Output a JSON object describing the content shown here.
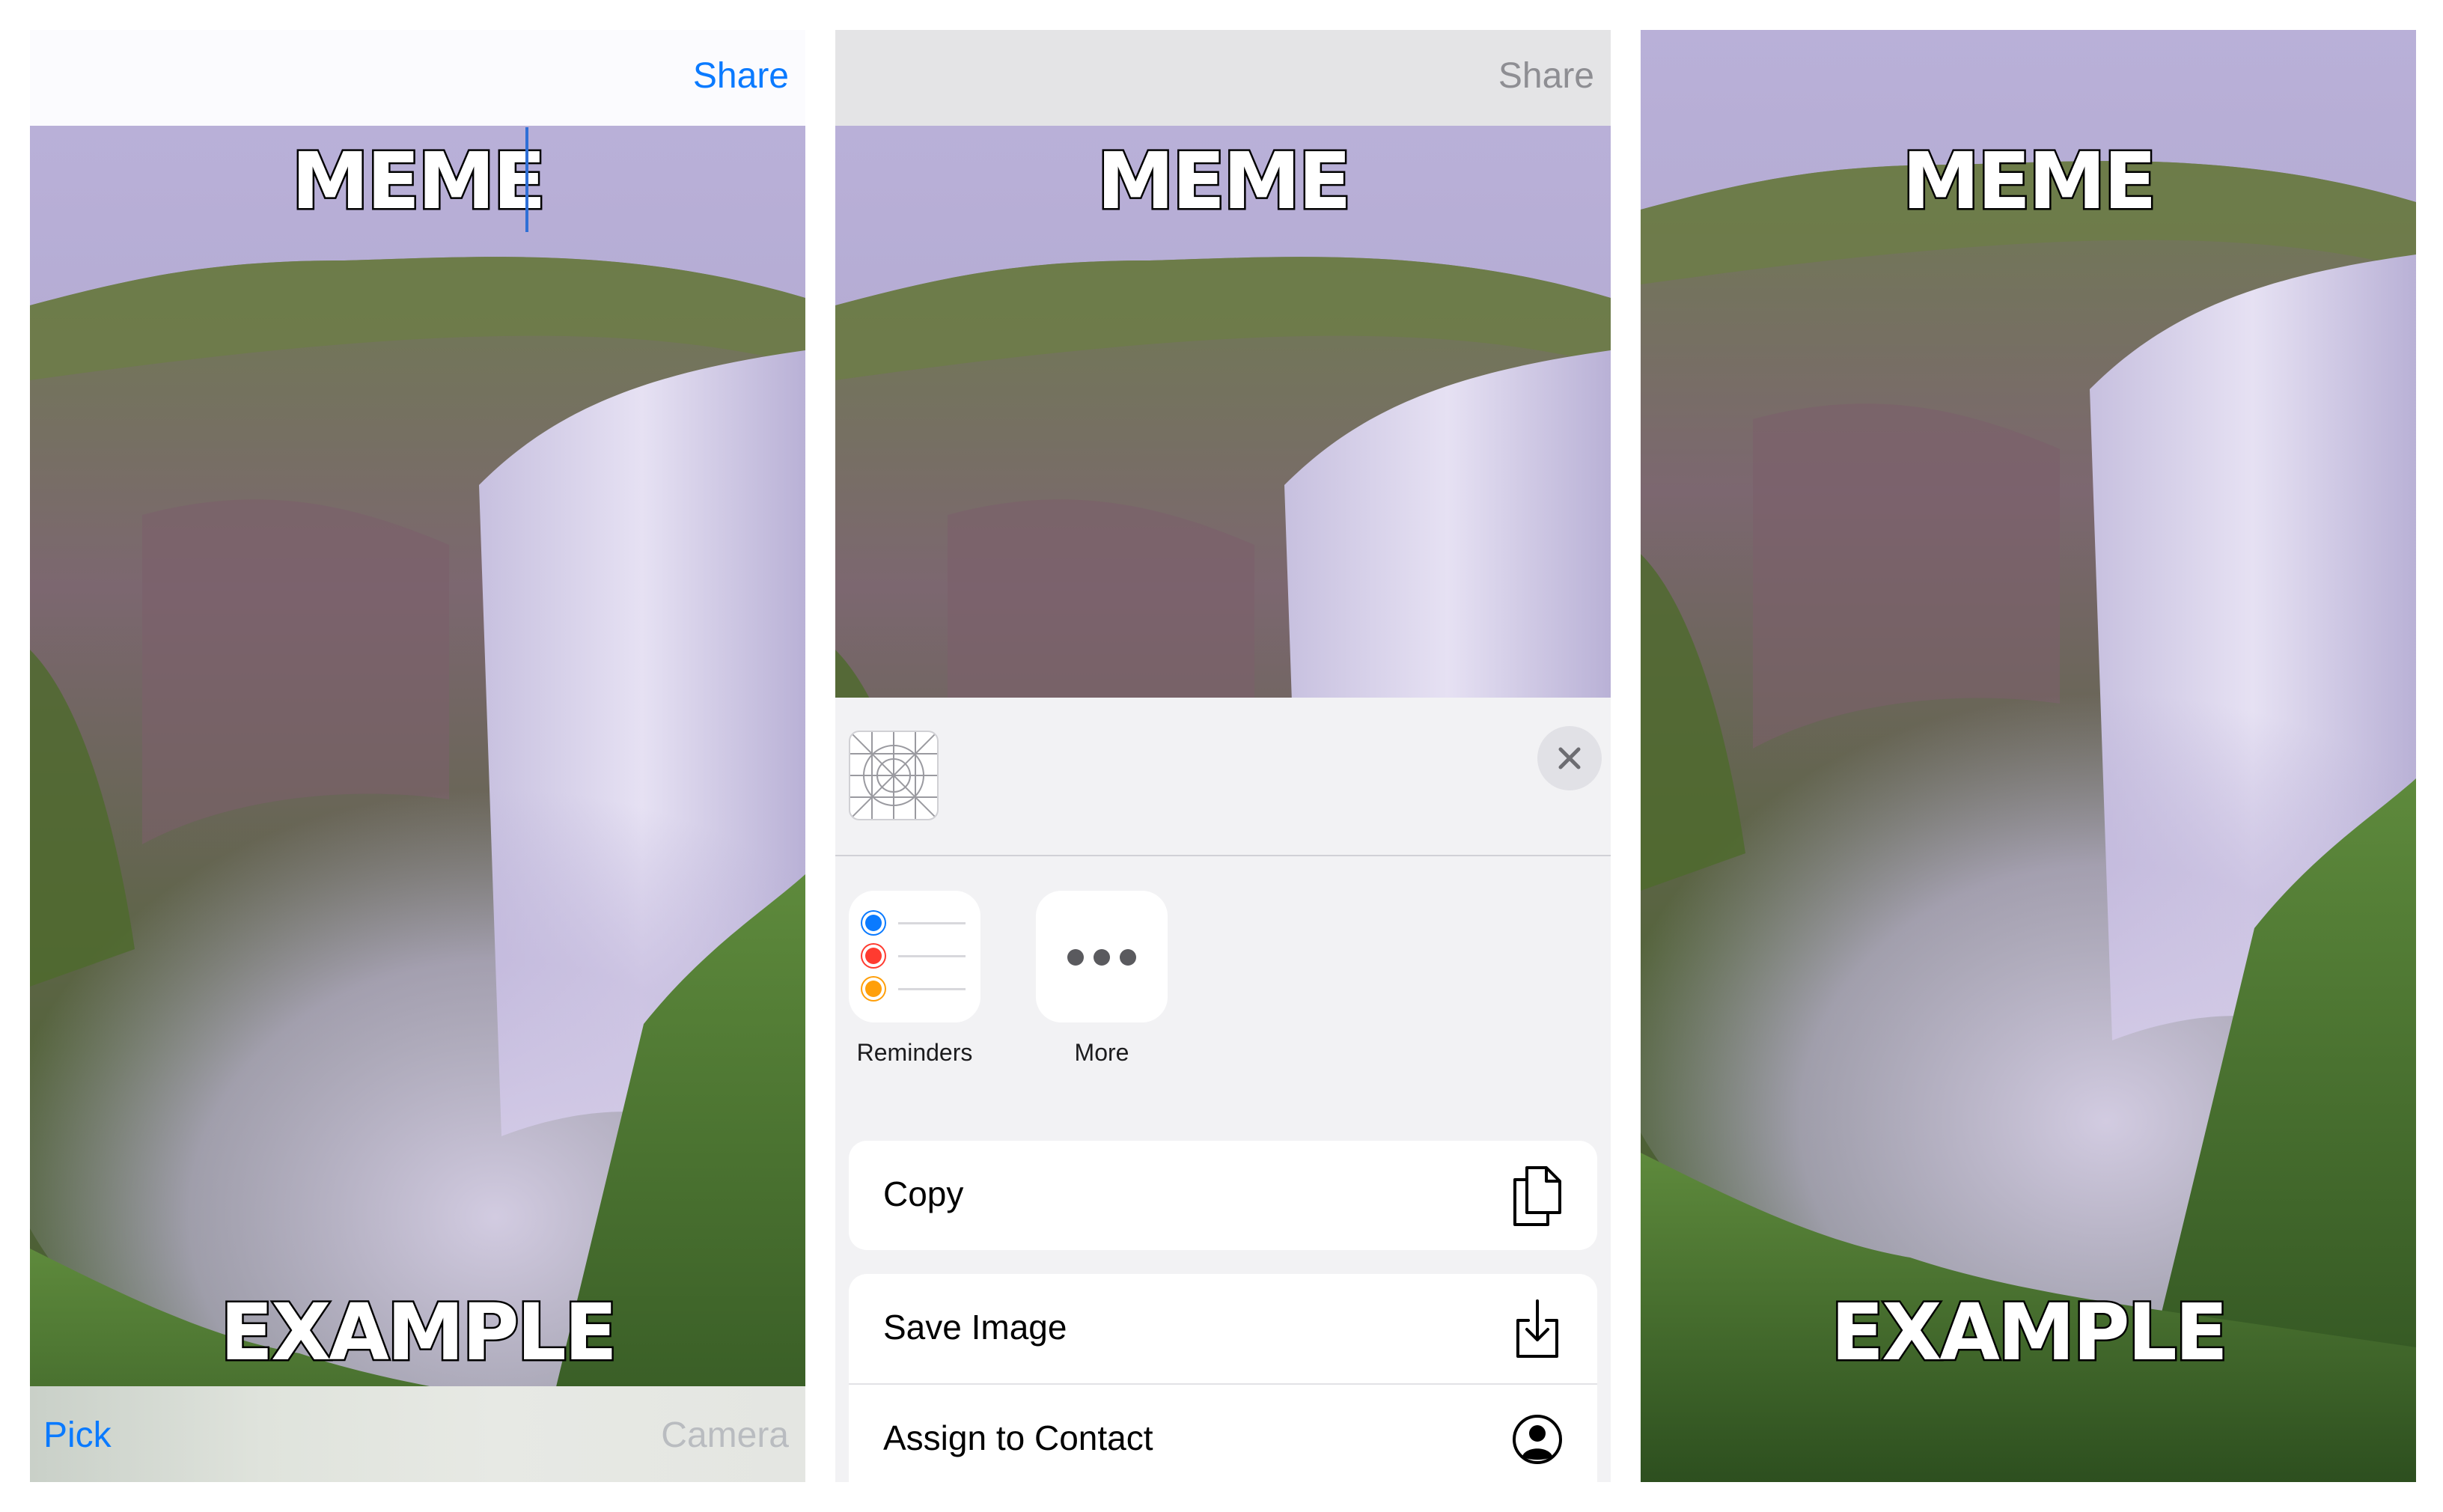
{
  "panel_left": {
    "nav": {
      "share_label": "Share"
    },
    "meme": {
      "top_text": "MEME",
      "bottom_text": "EXAMPLE"
    },
    "bottom_bar": {
      "pick_label": "Pick",
      "camera_label": "Camera"
    }
  },
  "panel_middle": {
    "nav": {
      "share_label": "Share"
    },
    "meme": {
      "top_text": "MEME"
    },
    "share_sheet": {
      "apps": [
        {
          "label": "Reminders",
          "icon": "reminders-icon"
        },
        {
          "label": "More",
          "icon": "more-icon"
        }
      ],
      "actions_group1": [
        {
          "label": "Copy",
          "icon": "copy-icon"
        }
      ],
      "actions_group2": [
        {
          "label": "Save Image",
          "icon": "save-image-icon"
        },
        {
          "label": "Assign to Contact",
          "icon": "contact-icon"
        }
      ]
    }
  },
  "panel_right": {
    "meme": {
      "top_text": "MEME",
      "bottom_text": "EXAMPLE"
    }
  },
  "colors": {
    "accent": "#0a7aff",
    "disabled": "#b9bcc0",
    "sky": "#b7aed6"
  }
}
